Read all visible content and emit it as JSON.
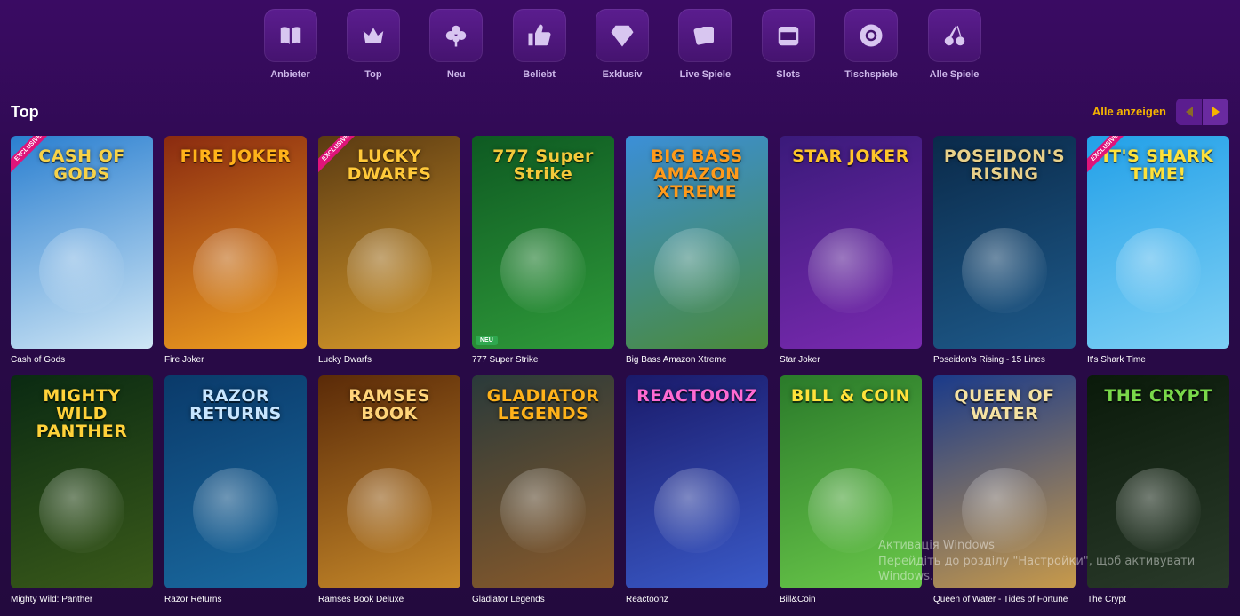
{
  "categories": [
    {
      "label": "Anbieter",
      "icon": "book-icon"
    },
    {
      "label": "Top",
      "icon": "crown-icon"
    },
    {
      "label": "Neu",
      "icon": "clover-icon"
    },
    {
      "label": "Beliebt",
      "icon": "thumbs-up-icon"
    },
    {
      "label": "Exklusiv",
      "icon": "diamond-icon"
    },
    {
      "label": "Live Spiele",
      "icon": "playing-cards-icon"
    },
    {
      "label": "Slots",
      "icon": "slot-machine-icon"
    },
    {
      "label": "Tischspiele",
      "icon": "poker-chip-icon"
    },
    {
      "label": "Alle Spiele",
      "icon": "cherries-icon"
    }
  ],
  "section": {
    "title": "Top",
    "show_all": "Alle anzeigen"
  },
  "games": [
    {
      "name": "Cash of Gods",
      "logo": "CASH OF GODS",
      "badge": "EXCLUSIVE",
      "color1": "#2a7fd0",
      "color2": "#cfe6f5",
      "text_color": "#f7d248"
    },
    {
      "name": "Fire Joker",
      "logo": "FIRE JOKER",
      "badge": "",
      "color1": "#8a2a10",
      "color2": "#f0a020",
      "text_color": "#ffb21a"
    },
    {
      "name": "Lucky Dwarfs",
      "logo": "LUCKY DWARFS",
      "badge": "EXCLUSIVE",
      "color1": "#5a3a12",
      "color2": "#d89a2a",
      "text_color": "#ffc93a"
    },
    {
      "name": "777 Super Strike",
      "logo": "777 Super Strike",
      "badge": "NEU",
      "color1": "#0e5a22",
      "color2": "#2f9a3a",
      "text_color": "#f3c93a"
    },
    {
      "name": "Big Bass Amazon Xtreme",
      "logo": "BIG BASS AMAZON XTREME",
      "badge": "",
      "color1": "#3b8fd8",
      "color2": "#4a8a3a",
      "text_color": "#ff9a1a"
    },
    {
      "name": "Star Joker",
      "logo": "STAR JOKER",
      "badge": "",
      "color1": "#3a1a7a",
      "color2": "#7a2ab0",
      "text_color": "#ffc62a"
    },
    {
      "name": "Poseidon's Rising - 15 Lines",
      "logo": "POSEIDON'S RISING",
      "badge": "",
      "color1": "#0a2a4a",
      "color2": "#1e5a8a",
      "text_color": "#e8d08a"
    },
    {
      "name": "It's Shark Time",
      "logo": "IT'S SHARK TIME!",
      "badge": "EXCLUSIVE",
      "color1": "#22a0e8",
      "color2": "#7ed0f5",
      "text_color": "#ffe23a"
    },
    {
      "name": "Mighty Wild: Panther",
      "logo": "MIGHTY WILD PANTHER",
      "badge": "",
      "color1": "#0a2a12",
      "color2": "#3a5a1a",
      "text_color": "#ffd23a"
    },
    {
      "name": "Razor Returns",
      "logo": "RAZOR RETURNS",
      "badge": "",
      "color1": "#0a3a6a",
      "color2": "#1a6aa0",
      "text_color": "#c8e6ff"
    },
    {
      "name": "Ramses Book Deluxe",
      "logo": "RAMSES BOOK",
      "badge": "",
      "color1": "#5a2a08",
      "color2": "#c88a2a",
      "text_color": "#ffd57a"
    },
    {
      "name": "Gladiator Legends",
      "logo": "GLADIATOR LEGENDS",
      "badge": "",
      "color1": "#2a3a3a",
      "color2": "#8a5a2a",
      "text_color": "#ffb21a"
    },
    {
      "name": "Reactoonz",
      "logo": "REACTOONZ",
      "badge": "",
      "color1": "#1a1a6a",
      "color2": "#3a5ac8",
      "text_color": "#ff6ad2"
    },
    {
      "name": "Bill&Coin",
      "logo": "BILL & COIN",
      "badge": "",
      "color1": "#2a7a2a",
      "color2": "#6ac84a",
      "text_color": "#ffe23a"
    },
    {
      "name": "Queen of Water - Tides of Fortune",
      "logo": "QUEEN OF WATER",
      "badge": "",
      "color1": "#1a3a8a",
      "color2": "#c89a4a",
      "text_color": "#f5e2a2"
    },
    {
      "name": "The Crypt",
      "logo": "THE CRYPT",
      "badge": "",
      "color1": "#0a1a0a",
      "color2": "#2a3a2a",
      "text_color": "#7ad84a"
    }
  ],
  "watermark": {
    "line1": "Активація Windows",
    "line2": "Перейдіть до розділу \"Настройки\", щоб активувати",
    "line3": "Windows."
  }
}
